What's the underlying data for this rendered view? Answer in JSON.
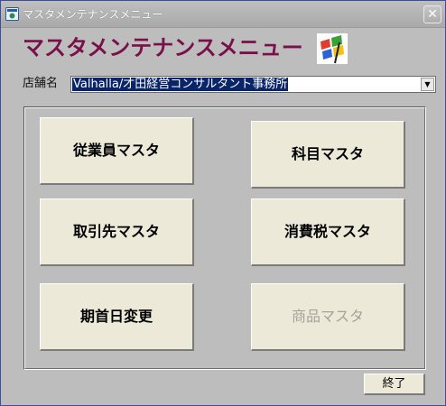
{
  "window": {
    "title": "マスタメンテナンスメニュー",
    "close_glyph": "✕",
    "icon": "app-window-icon"
  },
  "header": {
    "title": "マスタメンテナンスメニュー",
    "title_color": "#7a1049",
    "logo": "windows-flag-icon"
  },
  "store": {
    "label": "店舗名",
    "selected": "Valhalla/才田経営コンサルタント事務所",
    "dropdown_glyph": "▼"
  },
  "buttons": {
    "employee_master": "従業員マスタ",
    "account_master": "科目マスタ",
    "supplier_master": "取引先マスタ",
    "tax_master": "消費税マスタ",
    "fiscal_start_change": "期首日変更",
    "product_master": "商品マスタ",
    "product_master_disabled": true
  },
  "footer": {
    "close_label": "終了"
  }
}
